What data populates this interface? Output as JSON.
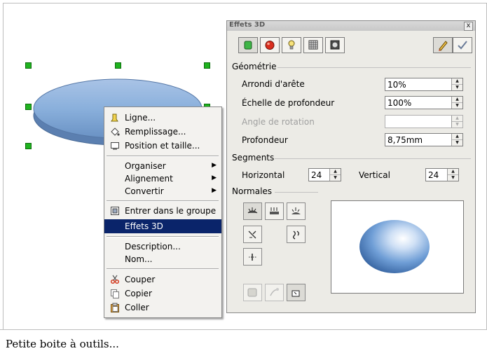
{
  "caption": "Petite boite à outils...",
  "context_menu": {
    "items": [
      {
        "label": "Ligne...",
        "icon": "line-icon"
      },
      {
        "label": "Remplissage...",
        "icon": "fill-icon"
      },
      {
        "label": "Position et taille...",
        "icon": "position-size-icon"
      },
      {
        "label": "Organiser",
        "submenu": true
      },
      {
        "label": "Alignement",
        "submenu": true
      },
      {
        "label": "Convertir",
        "submenu": true
      },
      {
        "label": "Entrer dans le groupe",
        "icon": "enter-group-icon"
      },
      {
        "label": "Effets 3D",
        "selected": true
      },
      {
        "label": "Description..."
      },
      {
        "label": "Nom..."
      },
      {
        "label": "Couper",
        "icon": "cut-icon"
      },
      {
        "label": "Copier",
        "icon": "copy-icon"
      },
      {
        "label": "Coller",
        "icon": "paste-icon"
      }
    ]
  },
  "dialog": {
    "title": "Effets 3D",
    "close": "x",
    "toolbar_icons": [
      "geometry-icon",
      "shading-icon",
      "lighting-icon",
      "textures-icon",
      "material-icon",
      "assign-icon",
      "update-icon"
    ],
    "geometry": {
      "heading": "Géométrie",
      "fields": [
        {
          "label": "Arrondi d'arête",
          "value": "10%",
          "enabled": true
        },
        {
          "label": "Échelle de profondeur",
          "value": "100%",
          "enabled": true
        },
        {
          "label": "Angle de rotation",
          "value": "",
          "enabled": false
        },
        {
          "label": "Profondeur",
          "value": "8,75mm",
          "enabled": true
        }
      ]
    },
    "segments": {
      "heading": "Segments",
      "horizontal_label": "Horizontal",
      "horizontal_value": "24",
      "vertical_label": "Vertical",
      "vertical_value": "24"
    },
    "normals": {
      "heading": "Normales"
    }
  },
  "colors": {
    "selection": "#0a246a",
    "handle": "#1fb31f",
    "shape_fill": "#86a8d4"
  }
}
